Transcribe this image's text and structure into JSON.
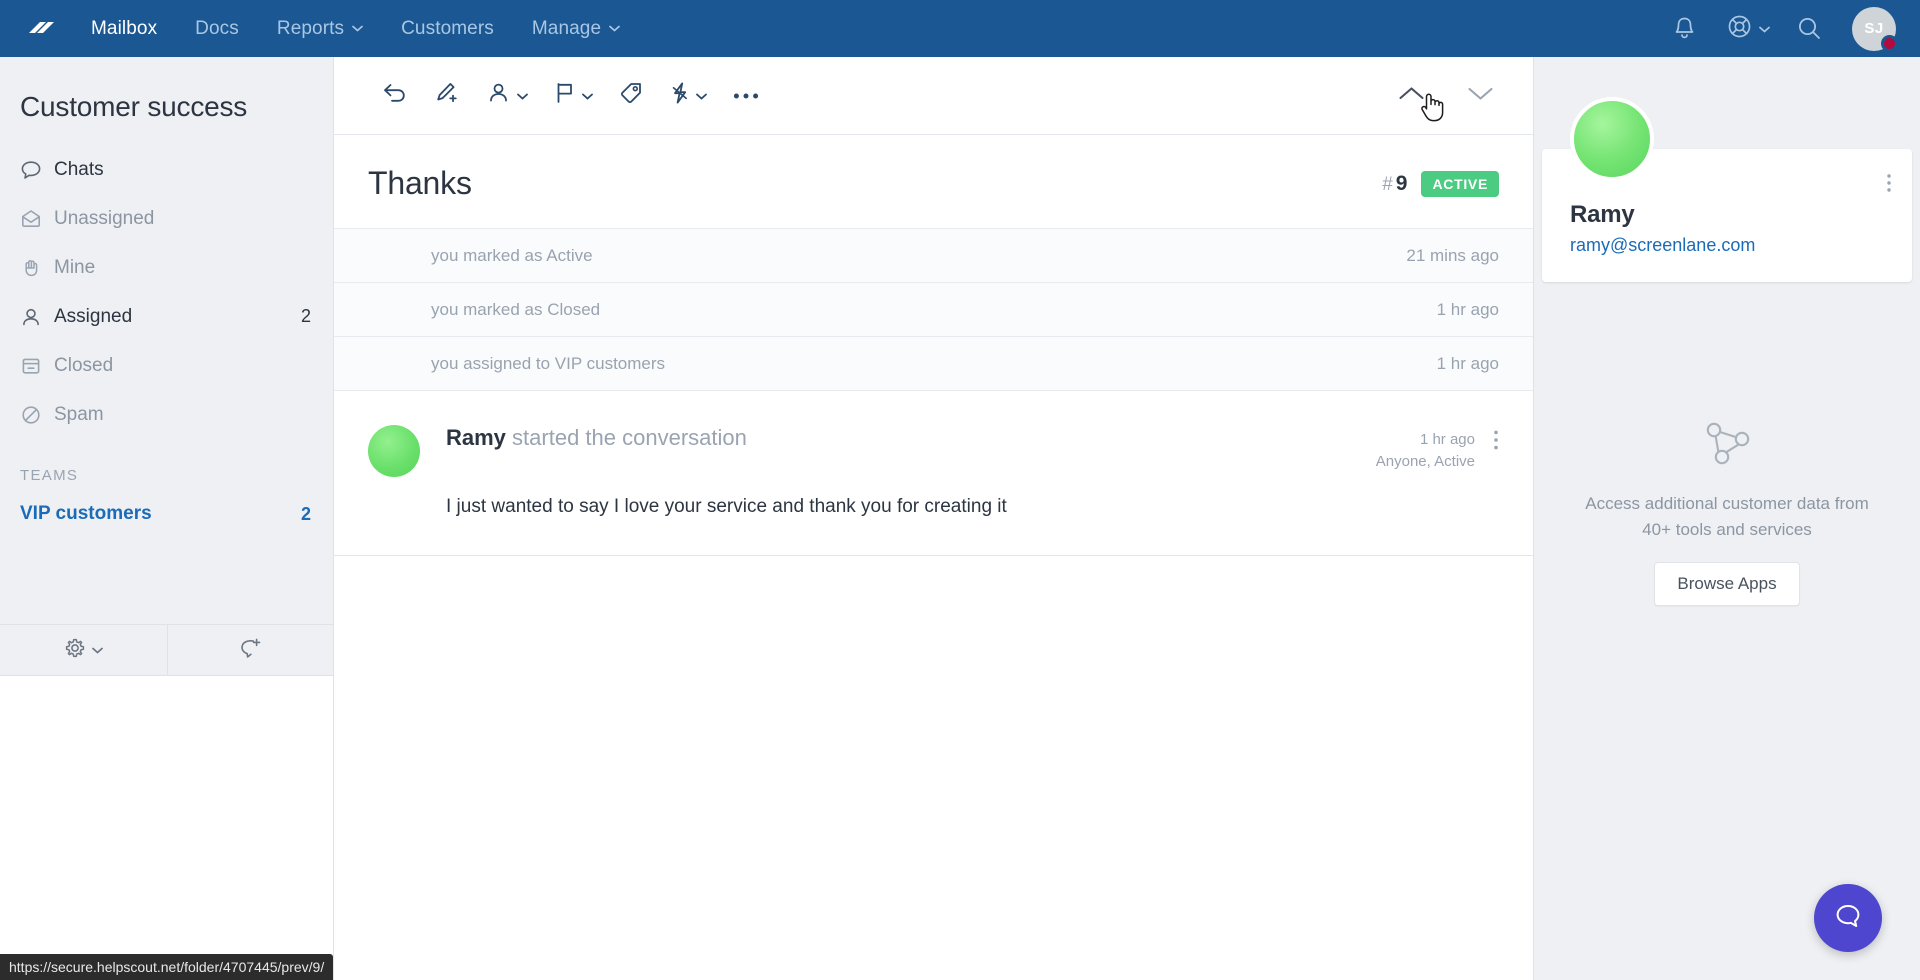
{
  "topnav": {
    "logo_icon": "helpscout-logo-icon",
    "items": [
      {
        "label": "Mailbox",
        "active": true,
        "caret": false
      },
      {
        "label": "Docs",
        "active": false,
        "caret": false
      },
      {
        "label": "Reports",
        "active": false,
        "caret": true
      },
      {
        "label": "Customers",
        "active": false,
        "caret": false
      },
      {
        "label": "Manage",
        "active": false,
        "caret": true
      }
    ],
    "icons": {
      "notifications": "bell-icon",
      "help": "life-ring-icon",
      "search": "search-icon"
    },
    "avatar_initials": "SJ",
    "brand_color": "#1b5792"
  },
  "sidebar": {
    "title": "Customer success",
    "folders": [
      {
        "label": "Chats",
        "icon": "chat-bubble-icon",
        "count": "",
        "emphasis": "dark"
      },
      {
        "label": "Unassigned",
        "icon": "envelope-open-icon",
        "count": "",
        "emphasis": "muted"
      },
      {
        "label": "Mine",
        "icon": "hand-icon",
        "count": "",
        "emphasis": "muted"
      },
      {
        "label": "Assigned",
        "icon": "person-icon",
        "count": "2",
        "emphasis": "dark"
      },
      {
        "label": "Closed",
        "icon": "archive-icon",
        "count": "",
        "emphasis": "muted"
      },
      {
        "label": "Spam",
        "icon": "no-entry-icon",
        "count": "",
        "emphasis": "muted"
      }
    ],
    "teams_heading": "TEAMS",
    "teams": [
      {
        "label": "VIP customers",
        "count": "2"
      }
    ],
    "footer": {
      "settings_icon": "gear-icon",
      "settings_caret_icon": "chevron-down-icon",
      "new_conversation_icon": "new-conversation-icon"
    },
    "accent_color": "#1a6bb8"
  },
  "toolbar": {
    "buttons": [
      {
        "name": "reply",
        "icon": "reply-arrow-icon",
        "caret": false
      },
      {
        "name": "add-note",
        "icon": "pencil-plus-icon",
        "caret": false
      },
      {
        "name": "assign",
        "icon": "person-assign-icon",
        "caret": true
      },
      {
        "name": "status",
        "icon": "flag-icon",
        "caret": true
      },
      {
        "name": "tag",
        "icon": "tag-icon",
        "caret": false
      },
      {
        "name": "saved-replies",
        "icon": "lightning-icon",
        "caret": true
      },
      {
        "name": "more",
        "icon": "ellipsis-horizontal-icon",
        "caret": false
      }
    ],
    "prev_icon": "chevron-up-icon",
    "next_icon": "chevron-down-icon",
    "cursor": "pointer-hand-cursor"
  },
  "conversation": {
    "subject": "Thanks",
    "number_hash": "#",
    "number": "9",
    "status_badge": "ACTIVE",
    "status_color": "#4ccb83",
    "activity": [
      {
        "text": "you marked as Active",
        "time": "21 mins ago"
      },
      {
        "text": "you marked as Closed",
        "time": "1 hr ago"
      },
      {
        "text": "you assigned to VIP customers",
        "time": "1 hr ago"
      }
    ],
    "messages": [
      {
        "author": "Ramy",
        "action": "started the conversation",
        "time": "1 hr ago",
        "assignment": "Anyone, Active",
        "text": "I just wanted to say I love your service and thank you for creating it",
        "kebab_icon": "ellipsis-vertical-icon"
      }
    ]
  },
  "right_panel": {
    "customer": {
      "name": "Ramy",
      "email": "ramy@screenlane.com",
      "kebab_icon": "ellipsis-vertical-icon",
      "avatar_icon": "customer-avatar"
    },
    "apps": {
      "icon": "apps-network-icon",
      "description": "Access additional customer data from 40+ tools and services",
      "button_label": "Browse Apps"
    }
  },
  "overlays": {
    "beacon_icon": "chat-bubble-icon",
    "beacon_color": "#4f46cf",
    "status_url": "https://secure.helpscout.net/folder/4707445/prev/9/"
  }
}
